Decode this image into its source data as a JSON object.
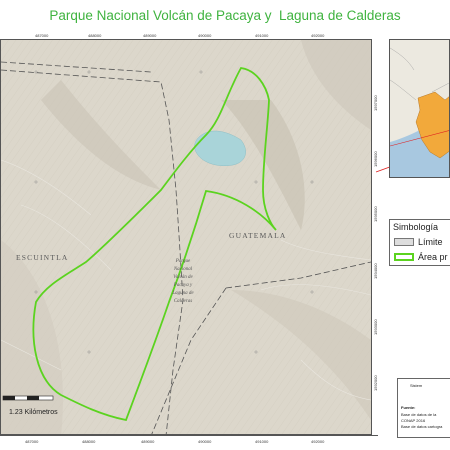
{
  "title": "Parque Nacional Volcán de Pacaya y  Laguna de Calderas",
  "map": {
    "x_ticks_top": [
      "487000",
      "488000",
      "489000",
      "490000",
      "491000",
      "492000"
    ],
    "x_ticks_bottom": [
      "487000",
      "488000",
      "489000",
      "490000",
      "491000",
      "492000"
    ],
    "y_ticks_right": [
      "1597000",
      "1596000",
      "1595000",
      "1594000",
      "1593000",
      "1592000"
    ],
    "departments": {
      "west": "ESCUINTLA",
      "east": "GUATEMALA"
    },
    "park_label": "Parque\nNacional\nVolcán de\nPacaya y\nLaguna de\nCalderas",
    "scale_label": "1.23 Kilómetros",
    "colors": {
      "protected_area": "#5bd31f",
      "water": "#a9d4d9",
      "terrain": "#d9d4c8",
      "boundary": "#555555"
    }
  },
  "inset": {
    "colors": {
      "sea": "#a8c8e0",
      "land": "#ece9e0",
      "guatemala": "#f2a93b",
      "marker": "#e02020"
    }
  },
  "legend": {
    "title": "Simbología",
    "items": [
      {
        "label": "Límite",
        "fill": "#dddddd",
        "stroke": "#777777"
      },
      {
        "label": "Área pr",
        "fill": "#ffffff",
        "stroke": "#5bd31f"
      }
    ]
  },
  "info": {
    "heading": "Sistem",
    "source_label": "Fuente:",
    "lines": [
      "Base de datos de la",
      "CONAP 2016",
      "Base de datos cartogra"
    ]
  }
}
